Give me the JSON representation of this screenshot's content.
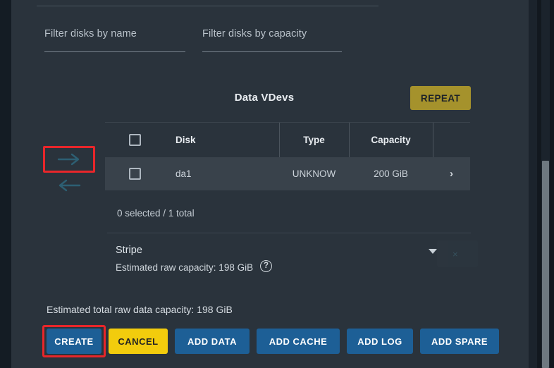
{
  "filters": {
    "name": {
      "placeholder": "Filter disks by name",
      "value": ""
    },
    "capacity": {
      "placeholder": "Filter disks by capacity",
      "value": ""
    }
  },
  "transfer": {
    "move_right_icon": "arrow-right-icon",
    "move_left_icon": "arrow-left-icon"
  },
  "vdev": {
    "title": "Data VDevs",
    "repeat_label": "REPEAT"
  },
  "table": {
    "columns": [
      "",
      "Disk",
      "Type",
      "Capacity",
      ""
    ],
    "header_checkbox": "select-all-checkbox",
    "rows": [
      {
        "checkbox": "row-select-checkbox",
        "disk": "da1",
        "type": "UNKNOW",
        "capacity": "200 GiB",
        "expand_icon": "chevron-right-icon"
      }
    ],
    "selection_summary": "0 selected / 1 total"
  },
  "layout_section": {
    "type_value": "Stripe",
    "dropdown_icon": "chevron-down-icon",
    "estimated_raw_capacity": "Estimated raw capacity: 198 GiB",
    "help_icon": "?"
  },
  "footer": {
    "estimated_total": "Estimated total raw data capacity: 198 GiB",
    "buttons": [
      {
        "label": "CREATE",
        "style": "blue",
        "highlighted": true
      },
      {
        "label": "CANCEL",
        "style": "yellow",
        "highlighted": false
      },
      {
        "label": "ADD DATA",
        "style": "blue",
        "highlighted": false
      },
      {
        "label": "ADD CACHE",
        "style": "blue",
        "highlighted": false
      },
      {
        "label": "ADD LOG",
        "style": "blue",
        "highlighted": false
      },
      {
        "label": "ADD SPARE",
        "style": "blue",
        "highlighted": false
      }
    ]
  },
  "colors": {
    "panel_bg": "#2a333c",
    "page_bg": "#12181f",
    "row_bg": "#39424b",
    "primary_button": "#1d5f96",
    "cancel_button": "#f2cc0d",
    "repeat_button": "#a5922c",
    "highlight_outline": "#e8262a",
    "scrollbar_thumb": "#6e7880"
  }
}
